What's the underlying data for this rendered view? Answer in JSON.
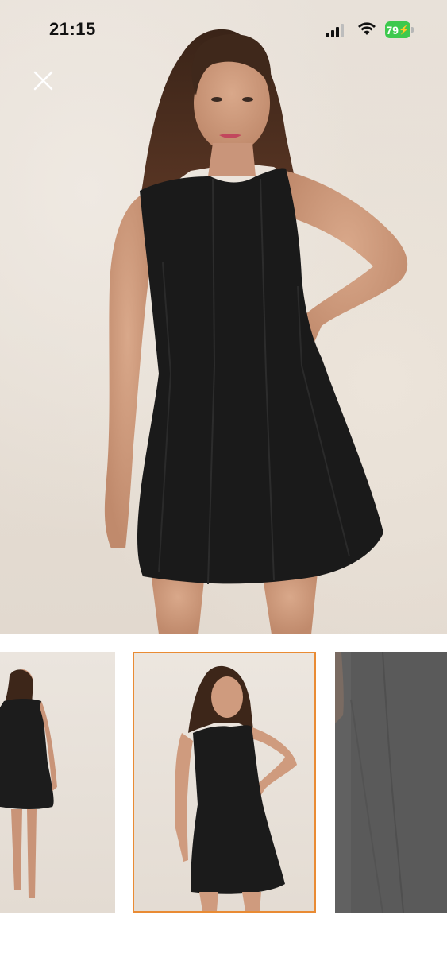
{
  "status_bar": {
    "time": "21:15",
    "battery": "79",
    "icons": [
      "cellular-signal-icon",
      "wifi-icon",
      "battery-charging-icon"
    ]
  },
  "viewer": {
    "close_icon": "close-icon",
    "selected_thumbnail": 2,
    "thumbnail_count": 3
  },
  "colors": {
    "selected_border": "#e98b34",
    "battery_green": "#3dc94e",
    "dress": "#1a1a1a"
  }
}
